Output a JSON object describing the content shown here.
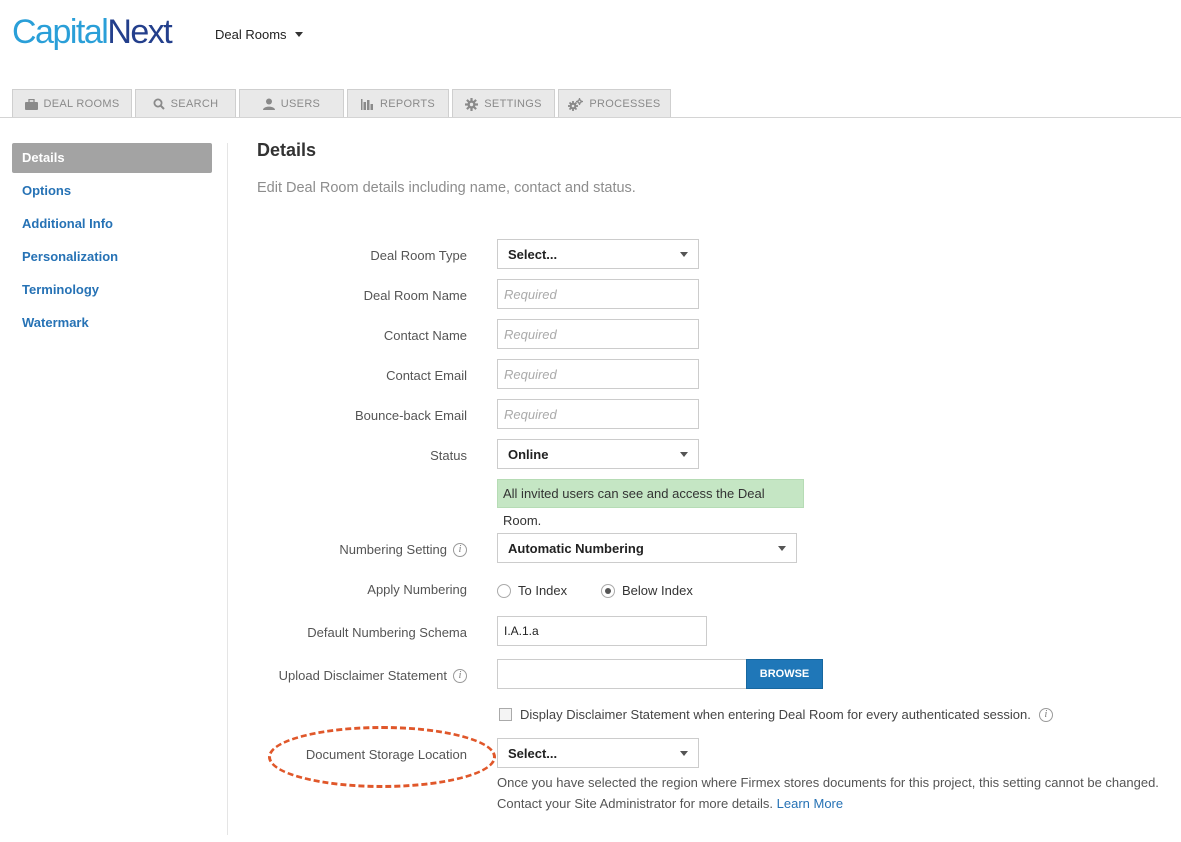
{
  "brand": {
    "logo_part1": "Capital",
    "logo_part2": "Next"
  },
  "header": {
    "room_switch_label": "Deal Rooms"
  },
  "tabs": [
    {
      "label": "DEAL ROOMS",
      "icon": "briefcase-icon"
    },
    {
      "label": "SEARCH",
      "icon": "search-icon"
    },
    {
      "label": "USERS",
      "icon": "user-icon"
    },
    {
      "label": "REPORTS",
      "icon": "bar-chart-icon"
    },
    {
      "label": "SETTINGS",
      "icon": "gear-icon"
    },
    {
      "label": "PROCESSES",
      "icon": "gears-icon"
    }
  ],
  "sidebar": {
    "items": [
      {
        "label": "Details",
        "active": true
      },
      {
        "label": "Options"
      },
      {
        "label": "Additional Info"
      },
      {
        "label": "Personalization"
      },
      {
        "label": "Terminology"
      },
      {
        "label": "Watermark"
      }
    ]
  },
  "main": {
    "title": "Details",
    "subtitle": "Edit Deal Room details including name, contact and status."
  },
  "form": {
    "deal_room_type": {
      "label": "Deal Room Type",
      "value": "Select..."
    },
    "deal_room_name": {
      "label": "Deal Room Name",
      "placeholder": "Required"
    },
    "contact_name": {
      "label": "Contact Name",
      "placeholder": "Required"
    },
    "contact_email": {
      "label": "Contact Email",
      "placeholder": "Required"
    },
    "bounce_email": {
      "label": "Bounce-back Email",
      "placeholder": "Required"
    },
    "status": {
      "label": "Status",
      "value": "Online",
      "note": "All invited users can see and access the Deal Room."
    },
    "numbering_setting": {
      "label": "Numbering Setting",
      "value": "Automatic Numbering"
    },
    "apply_numbering": {
      "label": "Apply Numbering",
      "option1": "To Index",
      "option2": "Below Index",
      "selected": "Below Index"
    },
    "numbering_schema": {
      "label": "Default Numbering Schema",
      "value": "I.A.1.a"
    },
    "disclaimer": {
      "label": "Upload Disclaimer Statement",
      "browse_label": "BROWSE",
      "checkbox_label": "Display Disclaimer Statement when entering Deal Room for every authenticated session.",
      "checked": false
    },
    "storage_location": {
      "label": "Document Storage Location",
      "value": "Select...",
      "help_line1": "Once you have selected the region where Firmex stores documents for this project, this setting cannot be changed.",
      "help_line2": "Contact your Site Administrator for more details.",
      "learn_more": "Learn More"
    }
  },
  "colors": {
    "brand_light": "#2a9fd8",
    "brand_dark": "#233f8c",
    "link": "#2672b5",
    "primary_button": "#1f77b8",
    "status_note_bg": "#c5e6c4",
    "annotation": "#e0572a"
  }
}
